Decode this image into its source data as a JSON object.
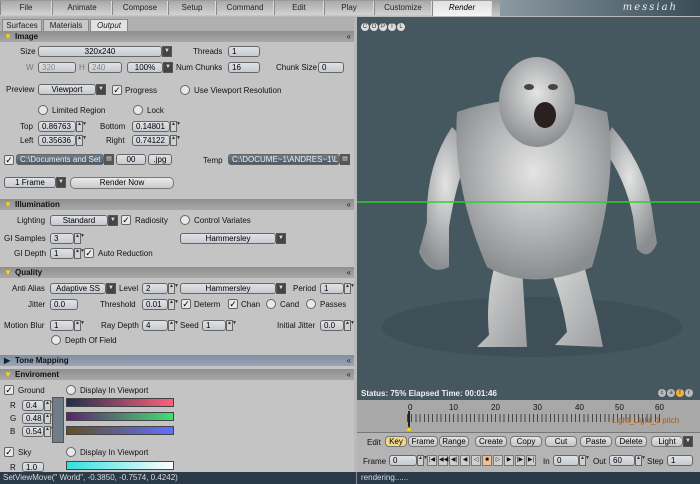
{
  "menu": {
    "tabs": [
      "File",
      "Animate",
      "Compose",
      "Setup",
      "Command",
      "Edit",
      "Play",
      "Customize",
      "Render"
    ],
    "active": "Render",
    "brand": "messiah"
  },
  "subtabs": {
    "items": [
      "Surfaces",
      "Materials",
      "Output"
    ],
    "active": "Output"
  },
  "image": {
    "title": "Image",
    "size_label": "Size",
    "size_value": "320x240",
    "threads_label": "Threads",
    "threads_value": "1",
    "w_label": "W",
    "w_value": "320",
    "h_label": "H",
    "h_value": "240",
    "zoom": "100%",
    "chunks_label": "Num Chunks",
    "chunks_value": "16",
    "chunk_size_label": "Chunk Size",
    "chunk_size_value": "0",
    "preview_label": "Preview",
    "preview_value": "Viewport",
    "progress_label": "Progress",
    "use_viewport_label": "Use Viewport Resolution",
    "limited_region_label": "Limited Region",
    "lock_label": "Lock",
    "top_label": "Top",
    "top_value": "0.86763",
    "bottom_label": "Bottom",
    "bottom_value": "0.14801",
    "left_label": "Left",
    "left_value": "0.35636",
    "right_label": "Right",
    "right_value": "0.74122",
    "path_value": "C:\\Documents and Set",
    "frame_value": "00",
    "ext_value": ".jpg",
    "temp_label": "Temp",
    "temp_value": "C:\\DOCUME~1\\ANDRES~1\\L",
    "frame_mode": "1 Frame",
    "render_now": "Render Now"
  },
  "illumination": {
    "title": "Illumination",
    "lighting_label": "Lighting",
    "lighting_value": "Standard",
    "radiosity_label": "Radiosity",
    "control_variates_label": "Control Variates",
    "gi_samples_label": "GI Samples",
    "gi_samples_value": "3",
    "sampler_value": "Hammersley",
    "gi_depth_label": "GI Depth",
    "gi_depth_value": "1",
    "auto_reduction_label": "Auto Reduction"
  },
  "quality": {
    "title": "Quality",
    "anti_alias_label": "Anti Alias",
    "anti_alias_value": "Adaptive SS",
    "level_label": "Level",
    "level_value": "2",
    "sampler_value": "Hammersley",
    "period_label": "Period",
    "period_value": "1",
    "jitter_label": "Jitter",
    "jitter_value": "0.0",
    "threshold_label": "Threshold",
    "threshold_value": "0.01",
    "determ_label": "Determ",
    "chan_label": "Chan",
    "cand_label": "Cand",
    "passes_label": "Passes",
    "motion_blur_label": "Motion Blur",
    "motion_blur_value": "1",
    "ray_depth_label": "Ray Depth",
    "ray_depth_value": "4",
    "seed_label": "Seed",
    "seed_value": "1",
    "initial_jitter_label": "Initial Jitter",
    "initial_jitter_value": "0.0",
    "dof_label": "Depth Of Field"
  },
  "tone_mapping": {
    "title": "Tone Mapping"
  },
  "environment": {
    "title": "Enviroment",
    "ground_label": "Ground",
    "display_label": "Display In Viewport",
    "r_label": "R",
    "r_value": "0.4",
    "g_label": "G",
    "g_value": "0.48",
    "b_label": "B",
    "b_value": "0.54",
    "sky_label": "Sky",
    "sky_display_label": "Display In Viewport",
    "sky_r_label": "R",
    "sky_r_value": "1.0"
  },
  "viewport": {
    "buttons": [
      "C",
      "O",
      "P",
      "T",
      "L"
    ],
    "status": "Status: 75%  Elapsed Time: 00:01:46",
    "corner_buttons": [
      "c",
      "a",
      "f",
      "r"
    ]
  },
  "timeline": {
    "ticks": [
      "0",
      "10",
      "20",
      "30",
      "40",
      "50",
      "60"
    ],
    "light_label": "Light_Light_1 pitch",
    "edit_label": "Edit",
    "key": "Key",
    "frame": "Frame",
    "range": "Range",
    "create": "Create",
    "copy": "Copy",
    "cut": "Cut",
    "paste": "Paste",
    "delete": "Delete",
    "light": "Light",
    "frame_label": "Frame",
    "frame_value": "0",
    "in_label": "In",
    "in_value": "0",
    "out_label": "Out",
    "out_value": "60",
    "step_label": "Step",
    "step_value": "1"
  },
  "status": {
    "command": "SetViewMove(\" World\", -0.3850, -0.7574, 0.4242)",
    "message": "rendering......"
  },
  "colors": {
    "viewport_bg": "#45575f",
    "accent_yellow": "#ffd800",
    "grid_green": "#33cc33",
    "status_bg": "#2a3a48"
  }
}
